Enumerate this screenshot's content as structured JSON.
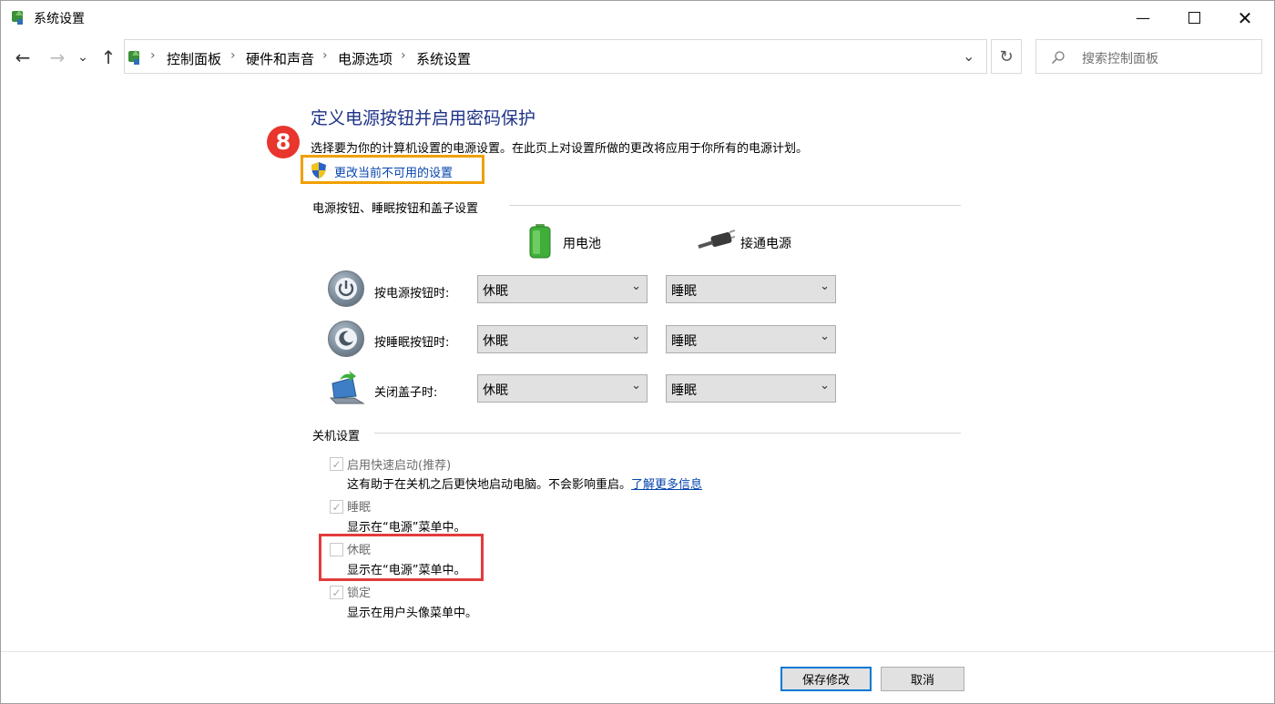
{
  "window": {
    "title": "系统设置",
    "icon": "control-panel-icon",
    "controls": {
      "minimize": "minimize-icon",
      "maximize": "maximize-icon",
      "close": "close-icon"
    }
  },
  "nav": {
    "back": "←",
    "forward": "→",
    "recent": "⌄",
    "up": "↑",
    "breadcrumb": [
      "控制面板",
      "硬件和声音",
      "电源选项",
      "系统设置"
    ],
    "refresh": "↻",
    "search_placeholder": "搜索控制面板"
  },
  "page": {
    "heading": "定义电源按钮并启用密码保护",
    "description": "选择要为你的计算机设置的电源设置。在此页上对设置所做的更改将应用于你所有的电源计划。",
    "step_badge": "8",
    "change_link": "更改当前不可用的设置"
  },
  "power_buttons": {
    "section_title": "电源按钮、睡眠按钮和盖子设置",
    "columns": {
      "battery": "用电池",
      "plugged_in": "接通电源"
    },
    "rows": [
      {
        "label": "按电源按钮时:",
        "battery": "休眠",
        "plugged_in": "睡眠"
      },
      {
        "label": "按睡眠按钮时:",
        "battery": "休眠",
        "plugged_in": "睡眠"
      },
      {
        "label": "关闭盖子时:",
        "battery": "休眠",
        "plugged_in": "睡眠"
      }
    ]
  },
  "shutdown": {
    "section_title": "关机设置",
    "items": [
      {
        "label": "启用快速启动(推荐)",
        "checked": true,
        "desc": "这有助于在关机之后更快地启动电脑。不会影响重启。",
        "link": "了解更多信息"
      },
      {
        "label": "睡眠",
        "checked": true,
        "desc": "显示在“电源”菜单中。"
      },
      {
        "label": "休眠",
        "checked": false,
        "desc": "显示在“电源”菜单中。"
      },
      {
        "label": "锁定",
        "checked": true,
        "desc": "显示在用户头像菜单中。"
      }
    ]
  },
  "footer": {
    "save": "保存修改",
    "cancel": "取消"
  },
  "colors": {
    "heading": "#1e3287",
    "link": "#0645ad",
    "badge": "#e8352d",
    "highlight_orange": "#f0a000",
    "highlight_red": "#e33b3b"
  }
}
